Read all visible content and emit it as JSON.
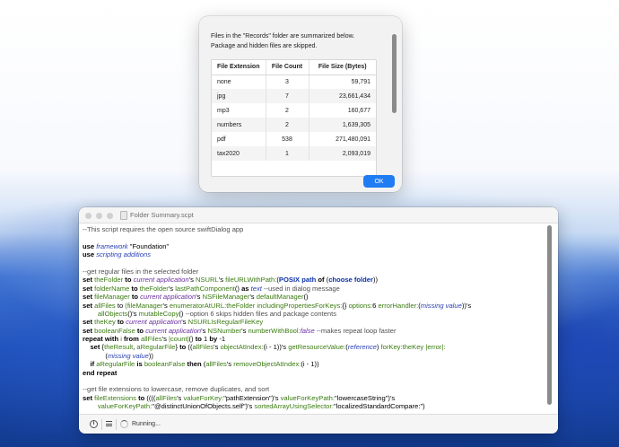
{
  "dialog": {
    "message_line1": "Files in the \"Records\" folder are summarized below.",
    "message_line2": "Package and hidden files are skipped.",
    "columns": [
      "File Extension",
      "File Count",
      "File Size (Bytes)"
    ],
    "rows": [
      {
        "ext": "none",
        "count": "3",
        "size": "59,791"
      },
      {
        "ext": "jpg",
        "count": "7",
        "size": "23,661,434"
      },
      {
        "ext": "mp3",
        "count": "2",
        "size": "160,677"
      },
      {
        "ext": "numbers",
        "count": "2",
        "size": "1,639,305"
      },
      {
        "ext": "pdf",
        "count": "538",
        "size": "271,480,091"
      },
      {
        "ext": "tax2020",
        "count": "1",
        "size": "2,093,019"
      }
    ],
    "ok_label": "OK"
  },
  "editor": {
    "title": "Folder Summary.scpt",
    "status": "Running...",
    "lines": [
      [
        {
          "t": "--This script requires the open source swiftDialog app",
          "c": "cmt"
        }
      ],
      [],
      [
        {
          "t": "use ",
          "c": "kw"
        },
        {
          "t": "framework",
          "c": "cls"
        },
        {
          "t": " \"Foundation\""
        }
      ],
      [
        {
          "t": "use ",
          "c": "kw"
        },
        {
          "t": "scripting additions",
          "c": "cls"
        }
      ],
      [],
      [
        {
          "t": "--get regular files in the selected folder",
          "c": "cmt"
        }
      ],
      [
        {
          "t": "set ",
          "c": "kw"
        },
        {
          "t": "theFolder",
          "c": "var"
        },
        {
          "t": " to ",
          "c": "kw"
        },
        {
          "t": "current application",
          "c": "app"
        },
        {
          "t": "'s "
        },
        {
          "t": "NSURL",
          "c": "var"
        },
        {
          "t": "'s "
        },
        {
          "t": "fileURLWithPath:",
          "c": "var"
        },
        {
          "t": "("
        },
        {
          "t": "POSIX path",
          "c": "fn"
        },
        {
          "t": " of ",
          "c": "kw"
        },
        {
          "t": "("
        },
        {
          "t": "choose folder",
          "c": "fn"
        },
        {
          "t": "))"
        }
      ],
      [
        {
          "t": "set ",
          "c": "kw"
        },
        {
          "t": "folderName",
          "c": "var"
        },
        {
          "t": " to ",
          "c": "kw"
        },
        {
          "t": "theFolder",
          "c": "var"
        },
        {
          "t": "'s "
        },
        {
          "t": "lastPathComponent",
          "c": "var"
        },
        {
          "t": "() "
        },
        {
          "t": "as ",
          "c": "kw"
        },
        {
          "t": "text",
          "c": "cls"
        },
        {
          "t": " --used in dialog message",
          "c": "cmt"
        }
      ],
      [
        {
          "t": "set ",
          "c": "kw"
        },
        {
          "t": "fileManager",
          "c": "var"
        },
        {
          "t": " to ",
          "c": "kw"
        },
        {
          "t": "current application",
          "c": "app"
        },
        {
          "t": "'s "
        },
        {
          "t": "NSFileManager",
          "c": "var"
        },
        {
          "t": "'s "
        },
        {
          "t": "defaultManager",
          "c": "var"
        },
        {
          "t": "()"
        }
      ],
      [
        {
          "t": "set ",
          "c": "kw"
        },
        {
          "t": "allFiles",
          "c": "var"
        },
        {
          "t": " to "
        },
        {
          "t": "(fileManager",
          "c": "var"
        },
        {
          "t": "'s "
        },
        {
          "t": "enumeratorAtURL:",
          "c": "var"
        },
        {
          "t": "theFolder",
          "c": "var"
        },
        {
          "t": " "
        },
        {
          "t": "includingPropertiesForKeys:",
          "c": "var"
        },
        {
          "t": "{} "
        },
        {
          "t": "options:",
          "c": "var"
        },
        {
          "t": "6 "
        },
        {
          "t": "errorHandler:",
          "c": "var"
        },
        {
          "t": "("
        },
        {
          "t": "missing value",
          "c": "cls"
        },
        {
          "t": "))'s"
        }
      ],
      [
        {
          "t": "        allObjects",
          "c": "var"
        },
        {
          "t": "()'s "
        },
        {
          "t": "mutableCopy",
          "c": "var"
        },
        {
          "t": "() "
        },
        {
          "t": "--option 6 skips hidden files and package contents",
          "c": "cmt"
        }
      ],
      [
        {
          "t": "set ",
          "c": "kw"
        },
        {
          "t": "theKey",
          "c": "var"
        },
        {
          "t": " to ",
          "c": "kw"
        },
        {
          "t": "current application",
          "c": "app"
        },
        {
          "t": "'s "
        },
        {
          "t": "NSURLIsRegularFileKey",
          "c": "var"
        }
      ],
      [
        {
          "t": "set ",
          "c": "kw"
        },
        {
          "t": "booleanFalse",
          "c": "var"
        },
        {
          "t": " to ",
          "c": "kw"
        },
        {
          "t": "current application",
          "c": "app"
        },
        {
          "t": "'s "
        },
        {
          "t": "NSNumber",
          "c": "var"
        },
        {
          "t": "'s "
        },
        {
          "t": "numberWithBool:",
          "c": "var"
        },
        {
          "t": "false",
          "c": "app"
        },
        {
          "t": " --makes repeat loop faster",
          "c": "cmt"
        }
      ],
      [
        {
          "t": "repeat with ",
          "c": "kw"
        },
        {
          "t": "i",
          "c": "var"
        },
        {
          "t": " from ",
          "c": "kw"
        },
        {
          "t": "allFiles",
          "c": "var"
        },
        {
          "t": "'s "
        },
        {
          "t": "|count|",
          "c": "var"
        },
        {
          "t": "() "
        },
        {
          "t": "to ",
          "c": "kw"
        },
        {
          "t": "1 "
        },
        {
          "t": "by ",
          "c": "kw"
        },
        {
          "t": "-1"
        }
      ],
      [
        {
          "t": "    "
        },
        {
          "t": "set ",
          "c": "kw"
        },
        {
          "t": "{"
        },
        {
          "t": "theResult",
          "c": "var"
        },
        {
          "t": ", "
        },
        {
          "t": "aRegularFile",
          "c": "var"
        },
        {
          "t": "} "
        },
        {
          "t": "to ",
          "c": "kw"
        },
        {
          "t": "(("
        },
        {
          "t": "allFiles",
          "c": "var"
        },
        {
          "t": "'s "
        },
        {
          "t": "objectAtIndex:",
          "c": "var"
        },
        {
          "t": "(i - 1))'s "
        },
        {
          "t": "getResourceValue:",
          "c": "var"
        },
        {
          "t": "("
        },
        {
          "t": "reference",
          "c": "cls"
        },
        {
          "t": ") "
        },
        {
          "t": "forKey:",
          "c": "var"
        },
        {
          "t": "theKey",
          "c": "var"
        },
        {
          "t": " "
        },
        {
          "t": "|error|:",
          "c": "var"
        }
      ],
      [
        {
          "t": "            ("
        },
        {
          "t": "missing value",
          "c": "cls"
        },
        {
          "t": "))"
        }
      ],
      [
        {
          "t": "    "
        },
        {
          "t": "if ",
          "c": "kw"
        },
        {
          "t": "aRegularFile",
          "c": "var"
        },
        {
          "t": " is ",
          "c": "kw"
        },
        {
          "t": "booleanFalse",
          "c": "var"
        },
        {
          "t": " then ",
          "c": "kw"
        },
        {
          "t": "("
        },
        {
          "t": "allFiles",
          "c": "var"
        },
        {
          "t": "'s "
        },
        {
          "t": "removeObjectAtIndex:",
          "c": "var"
        },
        {
          "t": "(i - 1))"
        }
      ],
      [
        {
          "t": "end repeat",
          "c": "kw"
        }
      ],
      [],
      [
        {
          "t": "--get file extensions to lowercase, remove duplicates, and sort",
          "c": "cmt"
        }
      ],
      [
        {
          "t": "set ",
          "c": "kw"
        },
        {
          "t": "fileExtensions",
          "c": "var"
        },
        {
          "t": " to ",
          "c": "kw"
        },
        {
          "t": "(((("
        },
        {
          "t": "allFiles",
          "c": "var"
        },
        {
          "t": "'s "
        },
        {
          "t": "valueForKey:",
          "c": "var"
        },
        {
          "t": "\"pathExtension\")'s "
        },
        {
          "t": "valueForKeyPath:",
          "c": "var"
        },
        {
          "t": "\"lowercaseString\")'s"
        }
      ],
      [
        {
          "t": "        valueForKeyPath:",
          "c": "var"
        },
        {
          "t": "\"@distinctUnionOfObjects.self\")'s "
        },
        {
          "t": "sortedArrayUsingSelector:",
          "c": "var"
        },
        {
          "t": "\"localizedStandardCompare:\")"
        }
      ]
    ]
  }
}
